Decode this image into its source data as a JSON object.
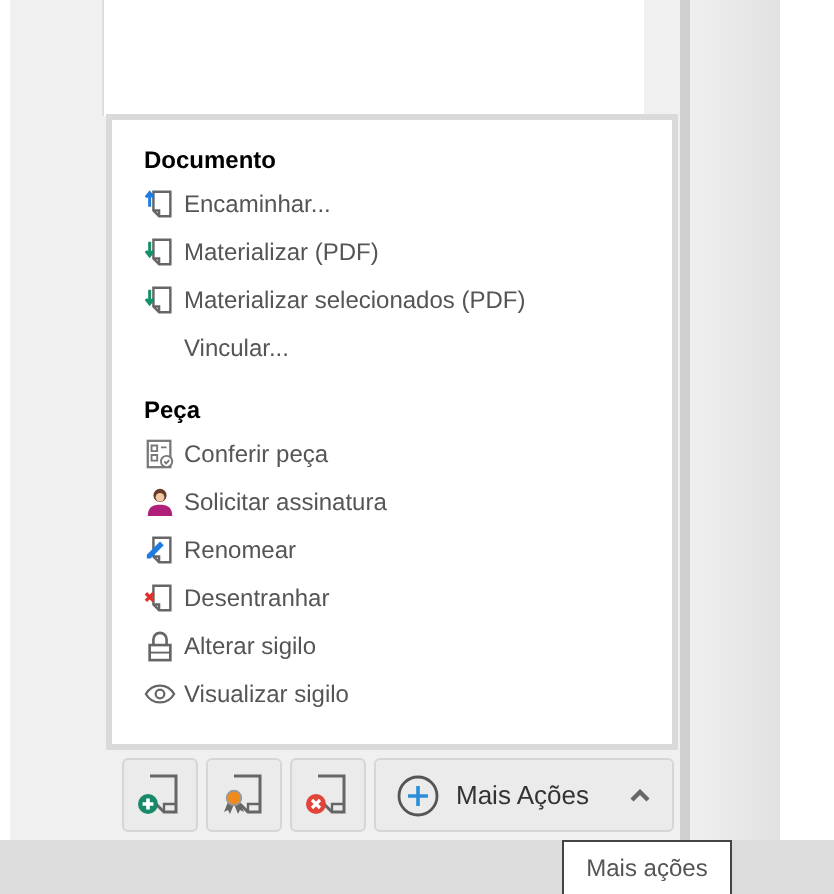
{
  "menu": {
    "sections": [
      {
        "title": "Documento",
        "items": [
          {
            "label": "Encaminhar..."
          },
          {
            "label": "Materializar (PDF)"
          },
          {
            "label": "Materializar selecionados (PDF)"
          },
          {
            "label": "Vincular..."
          }
        ]
      },
      {
        "title": "Peça",
        "items": [
          {
            "label": "Conferir peça"
          },
          {
            "label": "Solicitar assinatura"
          },
          {
            "label": "Renomear"
          },
          {
            "label": "Desentranhar"
          },
          {
            "label": "Alterar sigilo"
          },
          {
            "label": "Visualizar sigilo"
          }
        ]
      }
    ]
  },
  "toolbar": {
    "more_button": {
      "label": "Mais Ações",
      "expanded": true
    }
  },
  "tooltip": "Mais ações"
}
